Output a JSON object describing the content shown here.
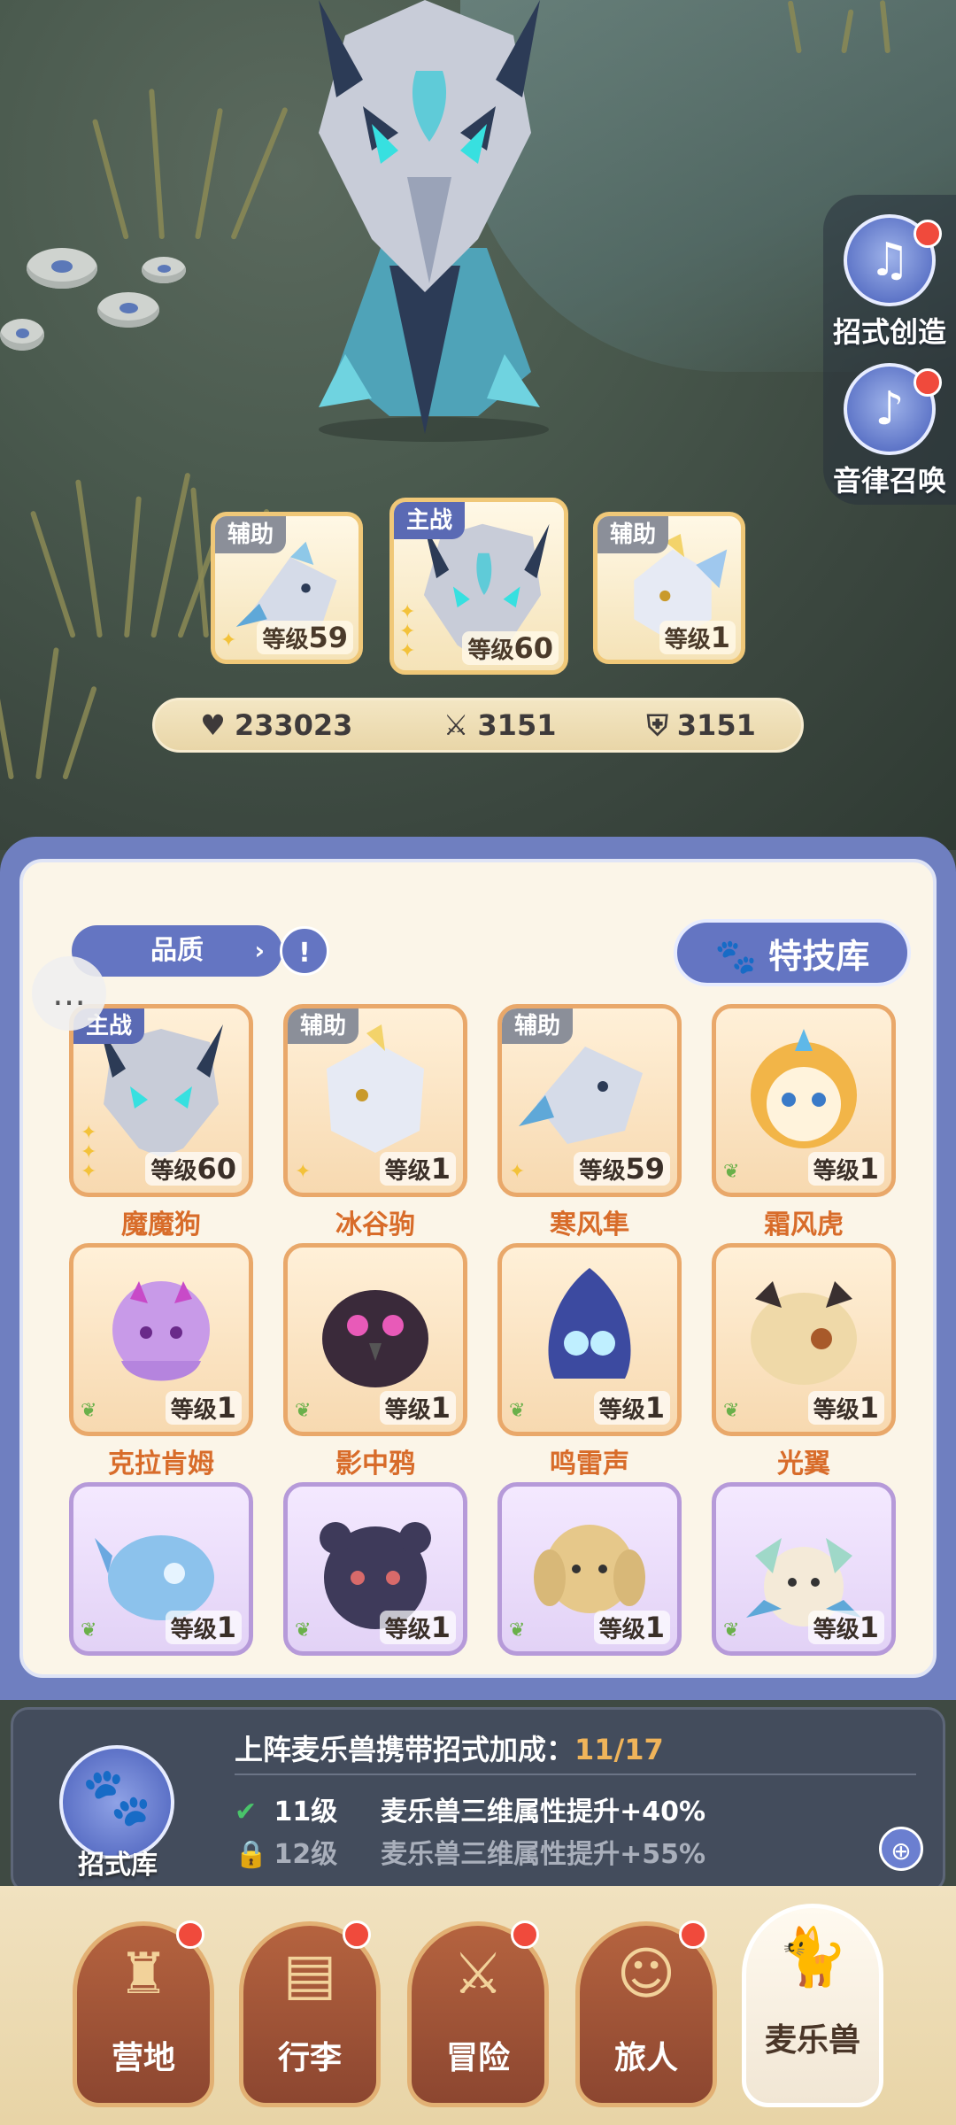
{
  "colors": {
    "panel": "#6f7fc0",
    "panel_inner": "#fbf5e8",
    "accent_blue": "#6475c2",
    "pet_name": "#d86c2a",
    "gold_border": "#e9a86a",
    "purple_border": "#b69ad9",
    "bonus_highlight": "#f0b45a",
    "nav_brown": "#b5633f"
  },
  "side_buttons": [
    {
      "label": "招式创造",
      "icon": "music-book-icon",
      "badge": true
    },
    {
      "label": "音律召唤",
      "icon": "lyre-icon",
      "badge": true
    }
  ],
  "team": [
    {
      "tag": "辅助",
      "level_prefix": "等级",
      "level": "59",
      "icon": "frost-griffin-icon"
    },
    {
      "tag": "主战",
      "level_prefix": "等级",
      "level": "60",
      "icon": "ice-dragon-icon"
    },
    {
      "tag": "辅助",
      "level_prefix": "等级",
      "level": "1",
      "icon": "ice-pony-icon"
    }
  ],
  "stats": {
    "hp": "233023",
    "attack": "3151",
    "defense": "3151"
  },
  "filter": {
    "label": "品质",
    "arrow": "›"
  },
  "notebook_icon": "!",
  "skill_library": {
    "label": "特技库",
    "icon": "paw-icon"
  },
  "pets": [
    {
      "name": "魔魔狗",
      "tag": "主战",
      "level": "60",
      "rarity": "gold"
    },
    {
      "name": "冰谷驹",
      "tag": "辅助",
      "level": "1",
      "rarity": "gold"
    },
    {
      "name": "寒风隼",
      "tag": "辅助",
      "level": "59",
      "rarity": "gold"
    },
    {
      "name": "霜风虎",
      "tag": "",
      "level": "1",
      "rarity": "gold"
    },
    {
      "name": "克拉肯姆",
      "tag": "",
      "level": "1",
      "rarity": "gold"
    },
    {
      "name": "影中鸦",
      "tag": "",
      "level": "1",
      "rarity": "gold"
    },
    {
      "name": "鸣雷声",
      "tag": "",
      "level": "1",
      "rarity": "gold"
    },
    {
      "name": "光翼",
      "tag": "",
      "level": "1",
      "rarity": "gold"
    },
    {
      "name": "",
      "tag": "",
      "level": "1",
      "rarity": "purple"
    },
    {
      "name": "",
      "tag": "",
      "level": "1",
      "rarity": "purple"
    },
    {
      "name": "",
      "tag": "",
      "level": "1",
      "rarity": "purple"
    },
    {
      "name": "",
      "tag": "",
      "level": "1",
      "rarity": "purple"
    }
  ],
  "level_prefix": "等级",
  "bonus": {
    "icon_label": "招式库",
    "title": "上阵麦乐兽携带招式加成：",
    "progress": "11/17",
    "progress_fraction": 0.647,
    "rows": [
      {
        "level": "11级",
        "text": "麦乐兽三维属性提升+40%",
        "unlocked": true
      },
      {
        "level": "12级",
        "text": "麦乐兽三维属性提升+55%",
        "unlocked": false
      }
    ]
  },
  "nav": [
    {
      "label": "营地",
      "icon": "castle-icon",
      "badge": true,
      "active": false
    },
    {
      "label": "行李",
      "icon": "backpack-icon",
      "badge": true,
      "active": false
    },
    {
      "label": "冒险",
      "icon": "crossed-swords-icon",
      "badge": true,
      "active": false
    },
    {
      "label": "旅人",
      "icon": "traveler-icon",
      "badge": true,
      "active": false
    },
    {
      "label": "麦乐兽",
      "icon": "pet-cat-icon",
      "badge": false,
      "active": true
    }
  ]
}
